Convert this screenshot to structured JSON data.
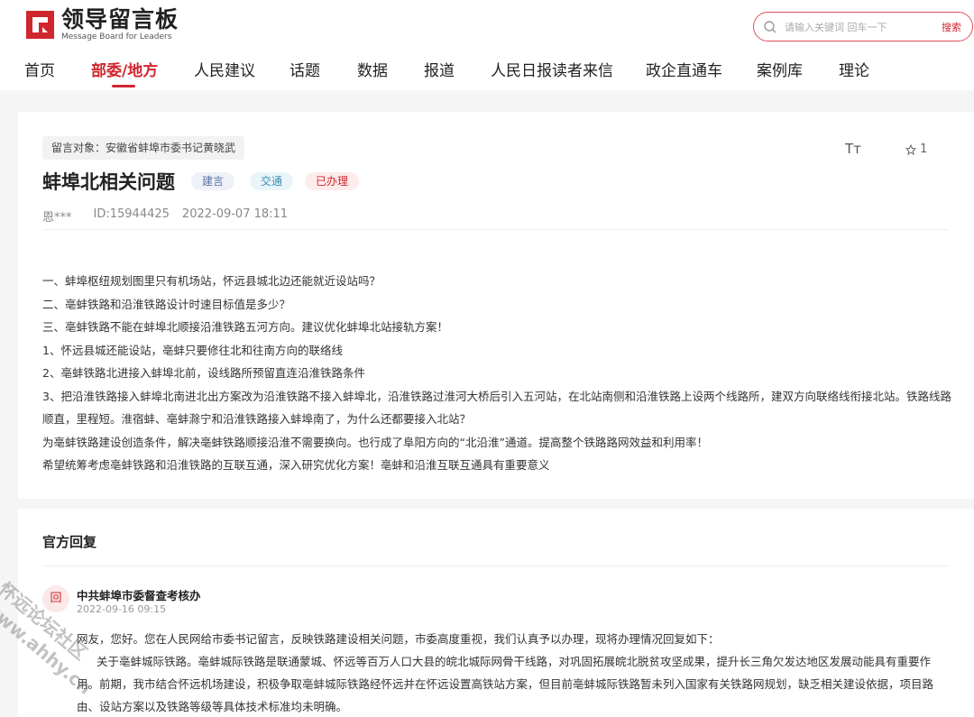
{
  "header": {
    "logo_title": "领导留言板",
    "logo_subtitle": "Message Board for Leaders",
    "search_placeholder": "请输入关键词 回车一下",
    "search_button": "搜索"
  },
  "nav": {
    "items": [
      "首页",
      "部委/地方",
      "人民建议",
      "话题",
      "数据",
      "报道",
      "人民日报读者来信",
      "政企直通车",
      "案例库",
      "理论"
    ],
    "active_index": 1
  },
  "message": {
    "target": "留言对象：安徽省蚌埠市委书记黄晓武",
    "title": "蚌埠北相关问题",
    "badges": {
      "type": "建言",
      "field": "交通",
      "status": "已办理"
    },
    "font_icon": "Tт",
    "fav_count": "1",
    "author": "恩***",
    "id": "ID:15944425",
    "datetime": "2022-09-07 18:11",
    "paragraphs": [
      "一、蚌埠枢纽规划图里只有机场站，怀远县城北边还能就近设站吗？",
      "二、亳蚌铁路和沿淮铁路设计时速目标值是多少？",
      "三、亳蚌铁路不能在蚌埠北顺接沿淮铁路五河方向。建议优化蚌埠北站接轨方案！",
      " 1、怀远县城还能设站，亳蚌只要修往北和往南方向的联络线",
      " 2、亳蚌铁路北进接入蚌埠北前，设线路所预留直连沿淮铁路条件",
      " 3、把沿淮铁路接入蚌埠北南进北出方案改为沿淮铁路不接入蚌埠北，沿淮铁路过淮河大桥后引入五河站，在北站南侧和沿淮铁路上设两个线路所，建双方向联络线衔接北站。铁路线路顺直，里程短。淮宿蚌、亳蚌滁宁和沿淮铁路接入蚌埠南了，为什么还都要接入北站？",
      "  为亳蚌铁路建设创造条件，解决亳蚌铁路顺接沿淮不需要换向。也行成了阜阳方向的“北沿淮”通道。提高整个铁路路网效益和利用率！",
      "希望统筹考虑亳蚌铁路和沿淮铁路的互联互通，深入研究优化方案！亳蚌和沿淮互联互通具有重要意义"
    ]
  },
  "reply": {
    "section_title": "官方回复",
    "avatar_text": "回",
    "replier": "中共蚌埠市委督查考核办",
    "time": "2022-09-16 09:15",
    "paragraphs": [
      "网友，您好。您在人民网给市委书记留言，反映铁路建设相关问题，市委高度重视，我们认真予以办理，现将办理情况回复如下：",
      "关于亳蚌城际铁路。亳蚌城际铁路是联通蒙城、怀远等百万人口大县的皖北城际网骨干线路，对巩固拓展皖北脱贫攻坚成果，提升长三角欠发达地区发展动能具有重要作用。前期，我市结合怀远机场建设，积极争取亳蚌城际铁路经怀远并在怀远设置高铁站方案，但目前亳蚌城际铁路暂未列入国家有关铁路网规划，缺乏相关建设依据，项目路由、设站方案以及铁路等级等具体技术标准均未明确。"
    ]
  },
  "watermark": {
    "line1": "怀远论坛社区",
    "line2": "www.ahhy.cn"
  },
  "colors": {
    "brand": "#d0262e"
  }
}
